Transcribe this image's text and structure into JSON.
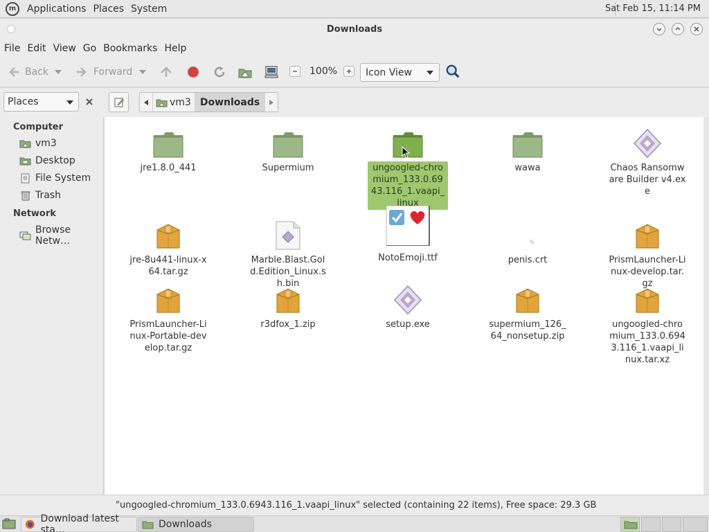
{
  "top_panel": {
    "menus": [
      "Applications",
      "Places",
      "System"
    ],
    "clock": "Sat Feb 15, 11:14 PM"
  },
  "window": {
    "title": "Downloads"
  },
  "menubar": [
    "File",
    "Edit",
    "View",
    "Go",
    "Bookmarks",
    "Help"
  ],
  "toolbar": {
    "back": "Back",
    "forward": "Forward",
    "zoom": "100%",
    "view_mode": "Icon View"
  },
  "location": {
    "pane_selector": "Places",
    "crumbs": [
      "vm3",
      "Downloads"
    ]
  },
  "sidebar": {
    "sections": [
      {
        "heading": "Computer",
        "items": [
          "vm3",
          "Desktop",
          "File System",
          "Trash"
        ]
      },
      {
        "heading": "Network",
        "items": [
          "Browse Netw…"
        ]
      }
    ]
  },
  "files": [
    {
      "name": "jre1.8.0_441",
      "type": "folder"
    },
    {
      "name": "Supermium",
      "type": "folder"
    },
    {
      "name": "ungoogled-chromium_133.0.6943.116_1.vaapi_linux",
      "type": "folder",
      "selected": true
    },
    {
      "name": "wawa",
      "type": "folder"
    },
    {
      "name": "Chaos Ransomware Builder v4.exe",
      "type": "exe"
    },
    {
      "name": "jre-8u441-linux-x64.tar.gz",
      "type": "archive"
    },
    {
      "name": "Marble.Blast.Gold.Edition_Linux.sh.bin",
      "type": "script"
    },
    {
      "name": "NotoEmoji.ttf",
      "type": "font"
    },
    {
      "name": "penis.crt",
      "type": "cert"
    },
    {
      "name": "PrismLauncher-Linux-develop.tar.gz",
      "type": "archive"
    },
    {
      "name": "PrismLauncher-Linux-Portable-develop.tar.gz",
      "type": "archive"
    },
    {
      "name": "r3dfox_1.zip",
      "type": "archive"
    },
    {
      "name": "setup.exe",
      "type": "exe"
    },
    {
      "name": "supermium_126_64_nonsetup.zip",
      "type": "archive"
    },
    {
      "name": "ungoogled-chromium_133.0.6943.116_1.vaapi_linux.tar.xz",
      "type": "archive"
    }
  ],
  "status": "\"ungoogled-chromium_133.0.6943.116_1.vaapi_linux\" selected (containing 22 items), Free space: 29.3 GB",
  "taskbar": {
    "tasks": [
      "Download latest sta…",
      "Downloads"
    ]
  },
  "colors": {
    "folder": "#8fae7a",
    "selection": "#9ec86f",
    "archive": "#e2a43c",
    "stop": "#d94040"
  }
}
